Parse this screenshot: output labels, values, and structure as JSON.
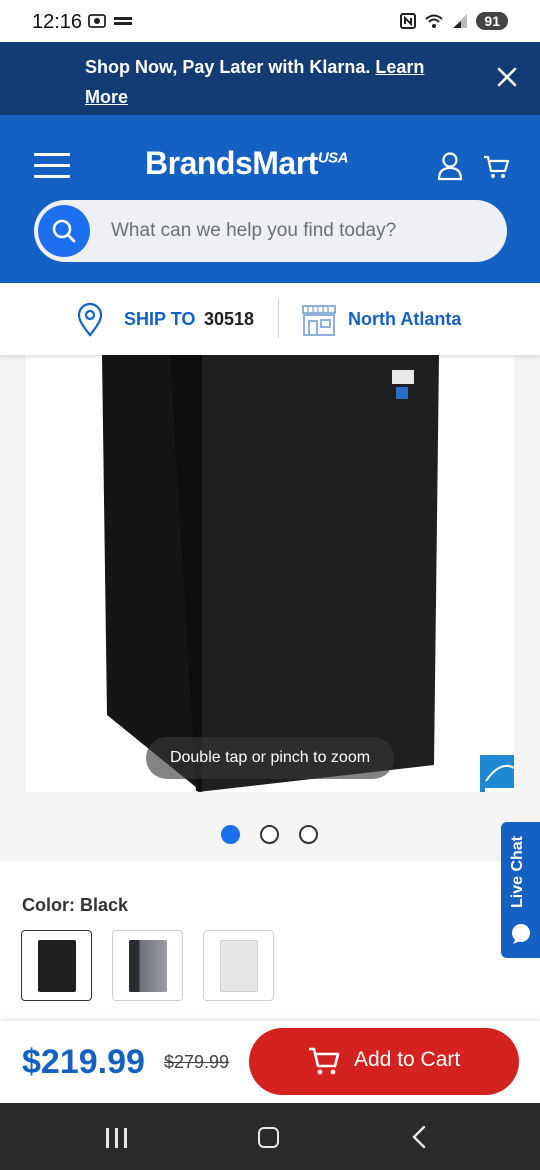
{
  "status": {
    "time": "12:16",
    "battery": "91"
  },
  "promo": {
    "text": "Shop Now, Pay Later with Klarna. ",
    "link": "Learn More"
  },
  "header": {
    "logo": "BrandsMart",
    "logo_suffix": "USA",
    "search_placeholder": "What can we help you find today?"
  },
  "shipping": {
    "label": "SHIP TO",
    "zip": "30518",
    "store": "North Atlanta"
  },
  "gallery": {
    "zoom_hint": "Double tap or pinch to zoom",
    "dot_count": 3,
    "active_dot": 0
  },
  "live_chat": {
    "label": "Live Chat"
  },
  "color": {
    "label": "Color: ",
    "value": "Black",
    "swatches": [
      {
        "name": "Black",
        "color": "#1f1f20",
        "selected": true
      },
      {
        "name": "Stainless",
        "color": "#5e6065",
        "selected": false
      },
      {
        "name": "White",
        "color": "#e6e6e6",
        "selected": false
      }
    ]
  },
  "purchase": {
    "price": "$219.99",
    "original_price": "$279.99",
    "add_to_cart": "Add to Cart"
  },
  "colors": {
    "brand_blue": "#1560c3",
    "promo_navy": "#123c73",
    "cta_red": "#d3221f"
  }
}
